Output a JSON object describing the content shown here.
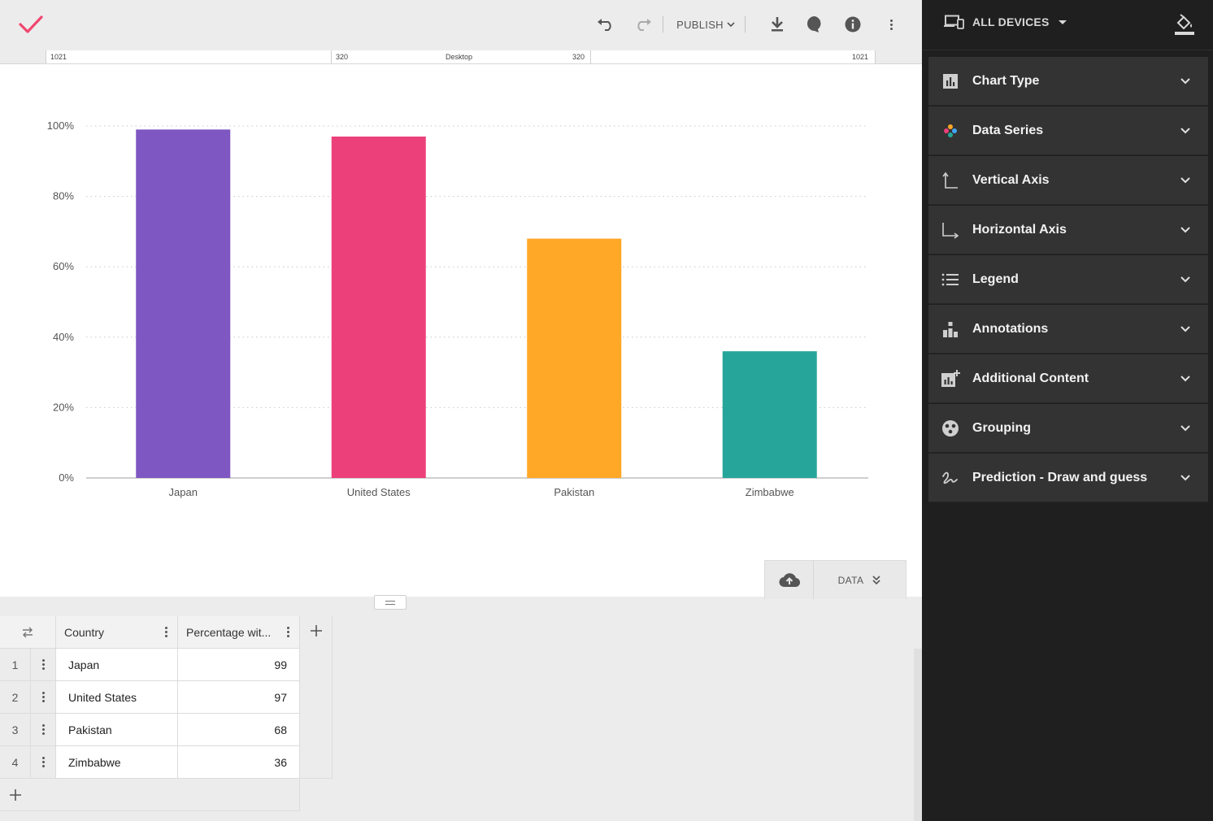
{
  "toolbar": {
    "publish_label": "PUBLISH"
  },
  "ruler": {
    "left_outer": "1021",
    "left_inner": "320",
    "center": "Desktop",
    "right_inner": "320",
    "right_outer": "1021"
  },
  "chart_data": {
    "type": "bar",
    "categories": [
      "Japan",
      "United States",
      "Pakistan",
      "Zimbabwe"
    ],
    "values": [
      99,
      97,
      68,
      36
    ],
    "colors": [
      "#7e57c2",
      "#ec407a",
      "#ffa726",
      "#26a69a"
    ],
    "yticks": [
      "0%",
      "20%",
      "40%",
      "60%",
      "80%",
      "100%"
    ],
    "ylim": [
      0,
      100
    ],
    "grid": true,
    "title": "",
    "xlabel": "",
    "ylabel": ""
  },
  "data_panel": {
    "toggle_label": "DATA"
  },
  "table": {
    "headers": [
      "Country",
      "Percentage wit..."
    ],
    "rows": [
      {
        "num": "1",
        "country": "Japan",
        "value": "99"
      },
      {
        "num": "2",
        "country": "United States",
        "value": "97"
      },
      {
        "num": "3",
        "country": "Pakistan",
        "value": "68"
      },
      {
        "num": "4",
        "country": "Zimbabwe",
        "value": "36"
      }
    ]
  },
  "right_panel": {
    "devices_label": "ALL DEVICES",
    "sections": [
      {
        "label": "Chart Type",
        "icon": "bar-chart-icon"
      },
      {
        "label": "Data Series",
        "icon": "palette-dots-icon"
      },
      {
        "label": "Vertical Axis",
        "icon": "vertical-axis-icon"
      },
      {
        "label": "Horizontal Axis",
        "icon": "horizontal-axis-icon"
      },
      {
        "label": "Legend",
        "icon": "list-icon"
      },
      {
        "label": "Annotations",
        "icon": "annotation-bars-icon"
      },
      {
        "label": "Additional Content",
        "icon": "add-chart-icon"
      },
      {
        "label": "Grouping",
        "icon": "grouping-icon"
      },
      {
        "label": "Prediction - Draw and guess",
        "icon": "draw-icon"
      }
    ]
  }
}
